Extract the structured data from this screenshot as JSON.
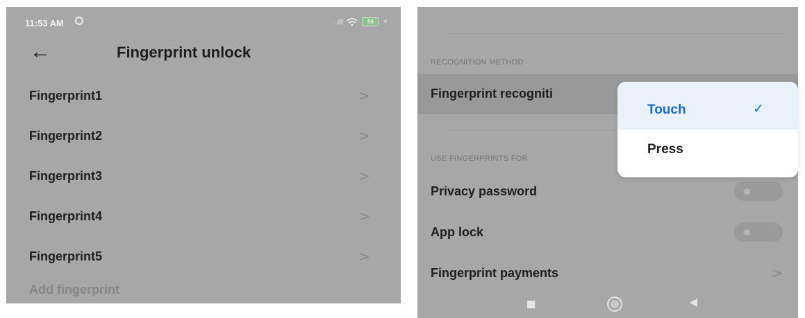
{
  "left_screen": {
    "status_bar": {
      "time": "11:53 AM",
      "signal_text": ".ıll",
      "battery_level": "50",
      "charging_symbol": "⚡"
    },
    "header": {
      "back_icon": "←",
      "title": "Fingerprint unlock"
    },
    "fingerprints": [
      {
        "label": "Fingerprint1",
        "chevron": ">"
      },
      {
        "label": "Fingerprint2",
        "chevron": ">"
      },
      {
        "label": "Fingerprint3",
        "chevron": ">"
      },
      {
        "label": "Fingerprint4",
        "chevron": ">"
      },
      {
        "label": "Fingerprint5",
        "chevron": ">"
      }
    ],
    "add_fingerprint": "Add fingerprint"
  },
  "right_screen": {
    "section_recognition": "RECOGNITION METHOD",
    "recognition_row_label": "Fingerprint recogniti",
    "section_use_for": "USE FINGERPRINTS FOR",
    "privacy_password": {
      "label": "Privacy password",
      "enabled": false
    },
    "app_lock": {
      "label": "App lock",
      "enabled": false
    },
    "fingerprint_payments": {
      "label": "Fingerprint payments",
      "chevron": ">"
    },
    "dropdown": {
      "options": [
        {
          "label": "Touch",
          "selected": true,
          "check": "✓"
        },
        {
          "label": "Press",
          "selected": false
        }
      ]
    }
  },
  "colors": {
    "dim_background": "#a7a7a7",
    "accent_blue": "#1769cf",
    "selected_option_bg": "#e9f1fb"
  }
}
